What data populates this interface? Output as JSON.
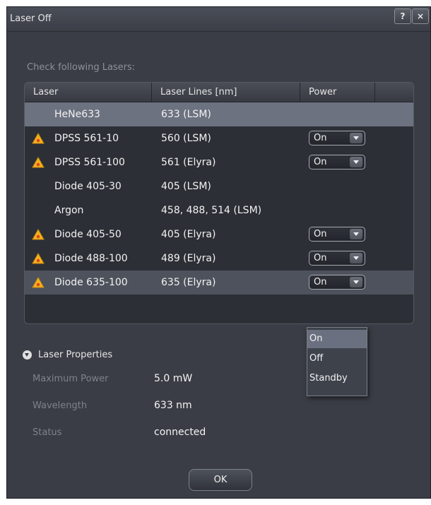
{
  "window": {
    "title": "Laser Off",
    "help_label": "?",
    "close_label": "×"
  },
  "check_label": "Check following Lasers:",
  "table": {
    "headers": [
      "Laser",
      "Laser Lines [nm]",
      "Power"
    ],
    "rows": [
      {
        "laser": "HeNe633",
        "lines": "633 (LSM)",
        "power": "",
        "warning": false
      },
      {
        "laser": "DPSS 561-10",
        "lines": "560 (LSM)",
        "power": "On",
        "warning": true
      },
      {
        "laser": "DPSS 561-100",
        "lines": "561 (Elyra)",
        "power": "On",
        "warning": true
      },
      {
        "laser": "Diode 405-30",
        "lines": "405 (LSM)",
        "power": "",
        "warning": false
      },
      {
        "laser": "Argon",
        "lines": "458, 488, 514 (LSM)",
        "power": "",
        "warning": false
      },
      {
        "laser": "Diode 405-50",
        "lines": "405 (Elyra)",
        "power": "On",
        "warning": true
      },
      {
        "laser": "Diode 488-100",
        "lines": "489 (Elyra)",
        "power": "On",
        "warning": true
      },
      {
        "laser": "Diode 635-100",
        "lines": "635 (Elyra)",
        "power": "On",
        "warning": true
      }
    ]
  },
  "power_menu": {
    "options": [
      "On",
      "Off",
      "Standby"
    ],
    "highlighted": "On"
  },
  "properties": {
    "title": "Laser Properties",
    "max_power_label": "Maximum Power",
    "max_power_value": "5.0 mW",
    "wavelength_label": "Wavelength",
    "wavelength_value": "633 nm",
    "status_label": "Status",
    "status_value": "connected"
  },
  "ok_label": "OK",
  "colors": {
    "warning_fill": "#f3b21b",
    "warning_dot": "#e23a2a",
    "background": "#3a3d45",
    "selected_row": "#6d7280"
  }
}
